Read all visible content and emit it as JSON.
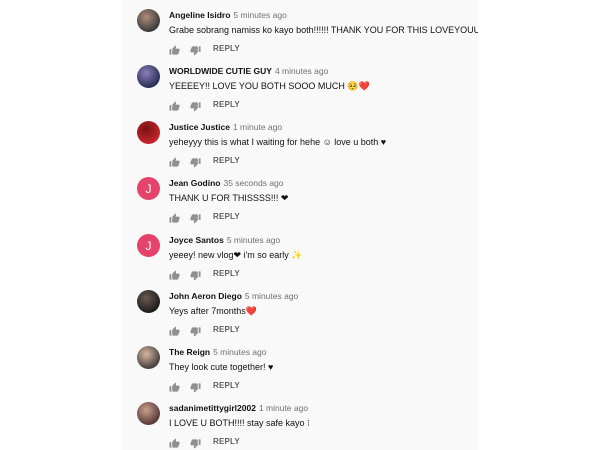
{
  "comments": [
    {
      "author": "Angeline Isidro",
      "time": "5 minutes ago",
      "text": "Grabe sobrang namiss ko kayo both!!!!!! THANK YOU FOR THIS LOVEYOUUUU",
      "avatar": {
        "type": "photo",
        "colors": [
          "#3c3c3c",
          "#b08d7c"
        ]
      },
      "reply": "REPLY"
    },
    {
      "author": "WORLDWIDE CUTIE GUY",
      "time": "4 minutes ago",
      "text": "YEEEEY!! LOVE YOU BOTH SOOO MUCH 🥺❤️",
      "avatar": {
        "type": "photo",
        "colors": [
          "#2b2f5a",
          "#8b7fb8"
        ]
      },
      "reply": "REPLY"
    },
    {
      "author": "Justice Justice",
      "time": "1 minute ago",
      "text": "yeheyyy this is what I waiting for hehe ☺ love u both ♥",
      "avatar": {
        "type": "photo",
        "colors": [
          "#c2262a",
          "#7a1012"
        ]
      },
      "reply": "REPLY"
    },
    {
      "author": "Jean Godino",
      "time": "35 seconds ago",
      "text": "THANK U FOR THISSSS!!! ❤",
      "avatar": {
        "type": "letter",
        "letter": "J",
        "colors": [
          "#e5436b",
          "#e5436b"
        ]
      },
      "reply": "REPLY"
    },
    {
      "author": "Joyce Santos",
      "time": "5 minutes ago",
      "text": "yeeey! new vlog❤ i'm so early ✨",
      "avatar": {
        "type": "letter",
        "letter": "J",
        "colors": [
          "#e5436b",
          "#e5436b"
        ]
      },
      "reply": "REPLY"
    },
    {
      "author": "John Aeron Diego",
      "time": "5 minutes ago",
      "text": "Yeys after 7months❤️",
      "avatar": {
        "type": "photo",
        "colors": [
          "#1d1d1d",
          "#6b5a50"
        ]
      },
      "reply": "REPLY"
    },
    {
      "author": "The Reign",
      "time": "5 minutes ago",
      "text": "They look cute together! ♥",
      "avatar": {
        "type": "photo",
        "colors": [
          "#4a4040",
          "#d6b7a4"
        ]
      },
      "reply": "REPLY"
    },
    {
      "author": "sadanimetittygirl2002",
      "time": "1 minute ago",
      "text": "I LOVE U BOTH!!!! stay safe kayo ⁝",
      "avatar": {
        "type": "photo",
        "colors": [
          "#5a3b3b",
          "#c9a08c"
        ]
      },
      "reply": "REPLY"
    }
  ],
  "icons": {
    "like": "thumbs-up-icon",
    "dislike": "thumbs-down-icon"
  },
  "colors": {
    "panel_bg": "#f9f9f9",
    "author": "#111111",
    "time": "#707070",
    "reply": "#606060",
    "letter_avatar": "#e5436b"
  }
}
